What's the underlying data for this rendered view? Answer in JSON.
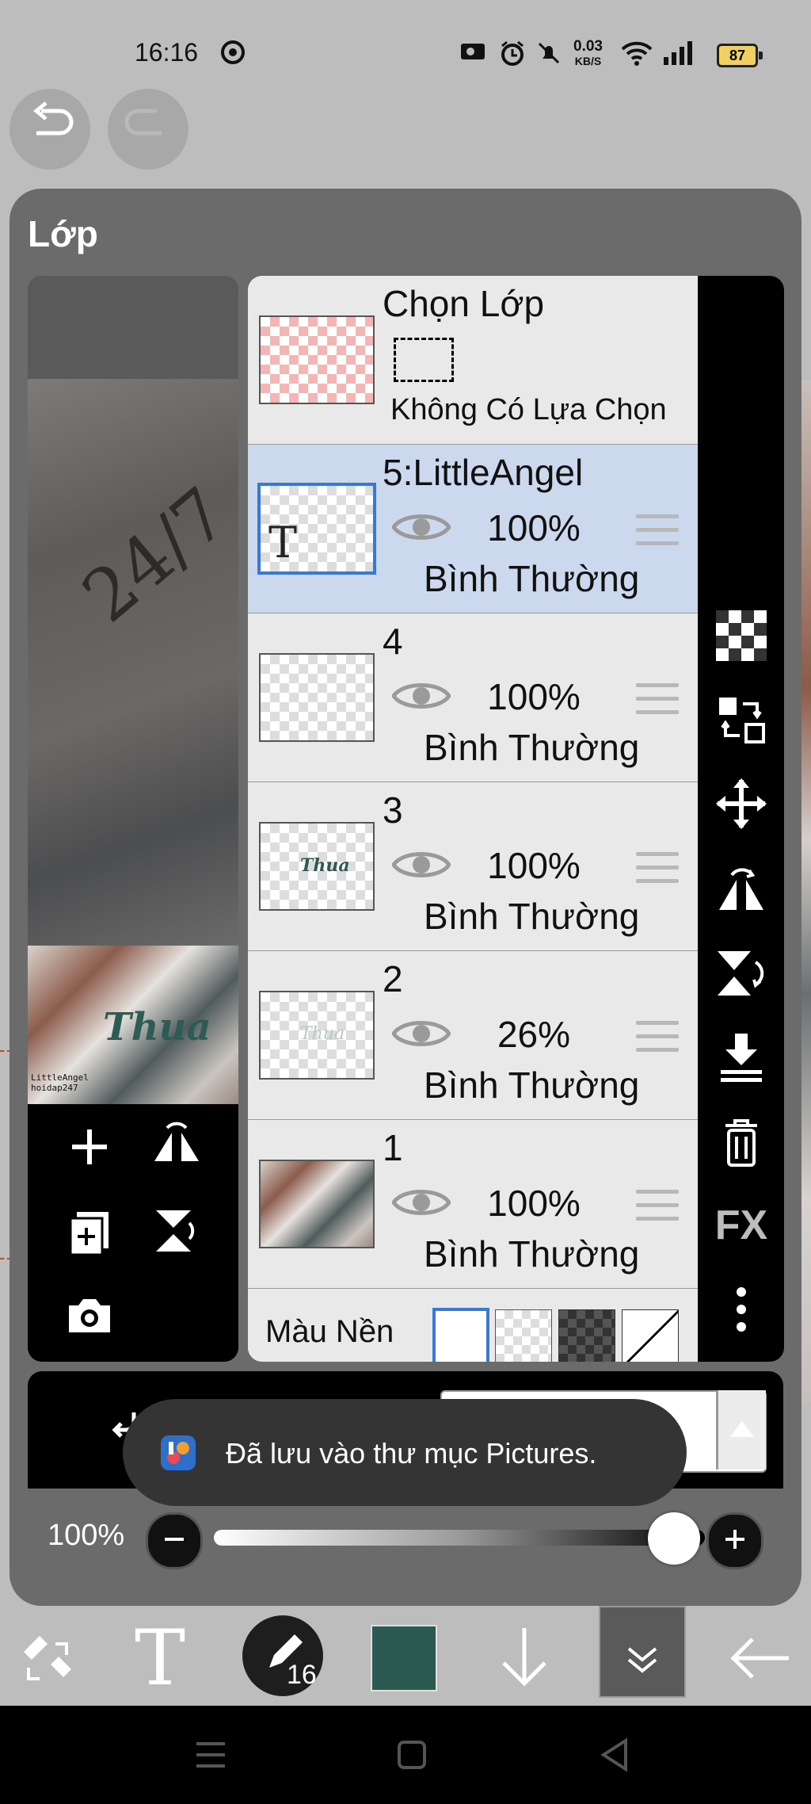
{
  "status_bar": {
    "time": "16:16",
    "speed_value": "0.03",
    "speed_unit": "KB/S",
    "battery": "87"
  },
  "panel": {
    "title": "Lớp"
  },
  "preview": {
    "signature": "LittleAngel\nhoidap247"
  },
  "selection_row": {
    "title": "Chọn Lớp",
    "status": "Không Có Lựa Chọn"
  },
  "layers": [
    {
      "name": "5:LittleAngel",
      "opacity": "100%",
      "blend": "Bình Thường",
      "selected": true
    },
    {
      "name": "4",
      "opacity": "100%",
      "blend": "Bình Thường",
      "selected": false
    },
    {
      "name": "3",
      "opacity": "100%",
      "blend": "Bình Thường",
      "selected": false
    },
    {
      "name": "2",
      "opacity": "26%",
      "blend": "Bình Thường",
      "selected": false
    },
    {
      "name": "1",
      "opacity": "100%",
      "blend": "Bình Thường",
      "selected": false
    }
  ],
  "background_row": {
    "label": "Màu Nền"
  },
  "side_toolbar": {
    "fx_label": "FX"
  },
  "opacity_control": {
    "value": "100%",
    "fraction": 1.0
  },
  "toast": {
    "message": "Đã lưu vào thư mục Pictures."
  },
  "bottom_toolbar": {
    "brush_size": "16",
    "color": "#2c5a52"
  },
  "colors": {
    "selected_row": "#ccd8ee",
    "selection_border": "#3a78d8",
    "toast_bg": "#343434"
  }
}
